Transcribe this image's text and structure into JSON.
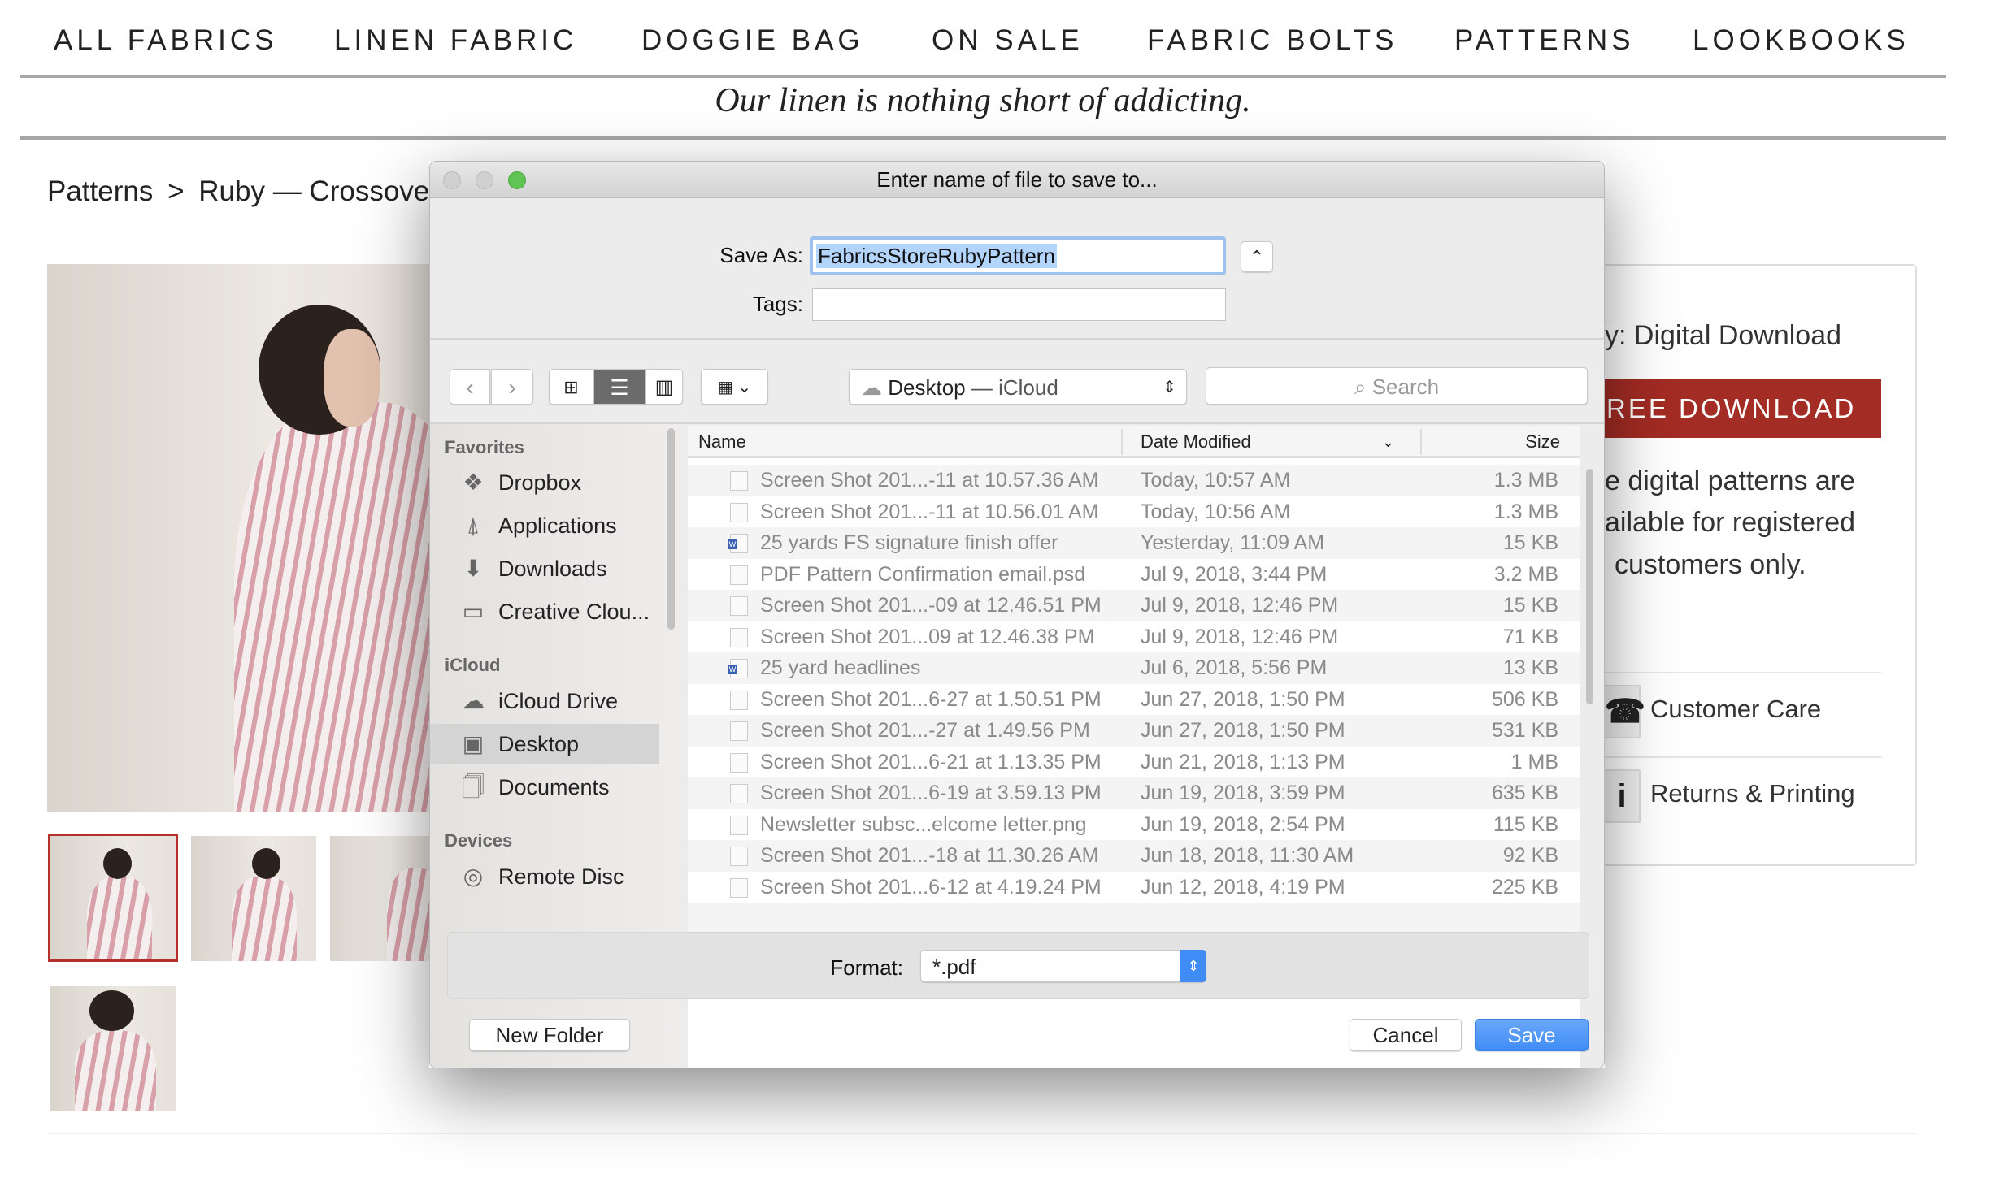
{
  "site": {
    "nav": [
      "ALL FABRICS",
      "LINEN FABRIC",
      "DOGGIE BAG",
      "ON SALE",
      "FABRIC BOLTS",
      "PATTERNS",
      "LOOKBOOKS"
    ],
    "tagline": "Our linen is nothing short of addicting.",
    "breadcrumb": {
      "root": "Patterns",
      "sep": ">",
      "current": "Ruby — Crossover L"
    },
    "panel": {
      "delivery": "y: Digital Download",
      "download_button": "REE DOWNLOAD",
      "note": [
        "e digital patterns are",
        "ailable for registered",
        "customers only."
      ],
      "customer_care": "Customer Care",
      "returns": "Returns & Printing"
    },
    "accent": "#a32c24"
  },
  "dialog": {
    "title": "Enter name of file to save to...",
    "save_as_label": "Save As:",
    "save_as_value": "FabricsStoreRubyPattern",
    "tags_label": "Tags:",
    "tags_value": "",
    "location": "Desktop",
    "location_suffix": "— iCloud",
    "search_placeholder": "Search",
    "sidebar": {
      "favorites_header": "Favorites",
      "favorites": [
        {
          "label": "Dropbox",
          "icon": "dropbox-icon"
        },
        {
          "label": "Applications",
          "icon": "applications-icon"
        },
        {
          "label": "Downloads",
          "icon": "downloads-icon"
        },
        {
          "label": "Creative Clou...",
          "icon": "folder-icon"
        }
      ],
      "icloud_header": "iCloud",
      "icloud": [
        {
          "label": "iCloud Drive",
          "icon": "cloud-icon"
        },
        {
          "label": "Desktop",
          "icon": "desktop-icon",
          "selected": true
        },
        {
          "label": "Documents",
          "icon": "documents-icon"
        }
      ],
      "devices_header": "Devices",
      "devices": [
        {
          "label": "Remote Disc",
          "icon": "disc-icon"
        }
      ]
    },
    "columns": {
      "name": "Name",
      "date": "Date Modified",
      "size": "Size"
    },
    "files": [
      {
        "name": "Screen Shot 201...-11 at 10.57.36 AM",
        "date": "Today, 10:57 AM",
        "size": "1.3 MB"
      },
      {
        "name": "Screen Shot 201...-11 at 10.56.01 AM",
        "date": "Today, 10:56 AM",
        "size": "1.3 MB"
      },
      {
        "name": "25 yards FS signature finish offer",
        "date": "Yesterday, 11:09 AM",
        "size": "15 KB",
        "word": true
      },
      {
        "name": "PDF Pattern Confirmation email.psd",
        "date": "Jul 9, 2018, 3:44 PM",
        "size": "3.2 MB"
      },
      {
        "name": "Screen Shot 201...-09 at 12.46.51 PM",
        "date": "Jul 9, 2018, 12:46 PM",
        "size": "15 KB"
      },
      {
        "name": "Screen Shot 201...09 at 12.46.38 PM",
        "date": "Jul 9, 2018, 12:46 PM",
        "size": "71 KB"
      },
      {
        "name": "25 yard headlines",
        "date": "Jul 6, 2018, 5:56 PM",
        "size": "13 KB",
        "word": true
      },
      {
        "name": "Screen Shot 201...6-27 at 1.50.51 PM",
        "date": "Jun 27, 2018, 1:50 PM",
        "size": "506 KB"
      },
      {
        "name": "Screen Shot 201...-27 at 1.49.56 PM",
        "date": "Jun 27, 2018, 1:50 PM",
        "size": "531 KB"
      },
      {
        "name": "Screen Shot 201...6-21 at 1.13.35 PM",
        "date": "Jun 21, 2018, 1:13 PM",
        "size": "1 MB"
      },
      {
        "name": "Screen Shot 201...6-19 at 3.59.13 PM",
        "date": "Jun 19, 2018, 3:59 PM",
        "size": "635 KB"
      },
      {
        "name": "Newsletter subsc...elcome letter.png",
        "date": "Jun 19, 2018, 2:54 PM",
        "size": "115 KB"
      },
      {
        "name": "Screen Shot 201...-18 at 11.30.26 AM",
        "date": "Jun 18, 2018, 11:30 AM",
        "size": "92 KB"
      },
      {
        "name": "Screen Shot 201...6-12 at 4.19.24 PM",
        "date": "Jun 12, 2018, 4:19 PM",
        "size": "225 KB"
      }
    ],
    "format_label": "Format:",
    "format_value": "*.pdf",
    "new_folder": "New Folder",
    "cancel": "Cancel",
    "save": "Save",
    "colors": {
      "selection": "#b3d4fc",
      "save_button": "#3f8cf7",
      "close_light": "#d0d0d0",
      "zoom_light": "#5fc453"
    }
  }
}
